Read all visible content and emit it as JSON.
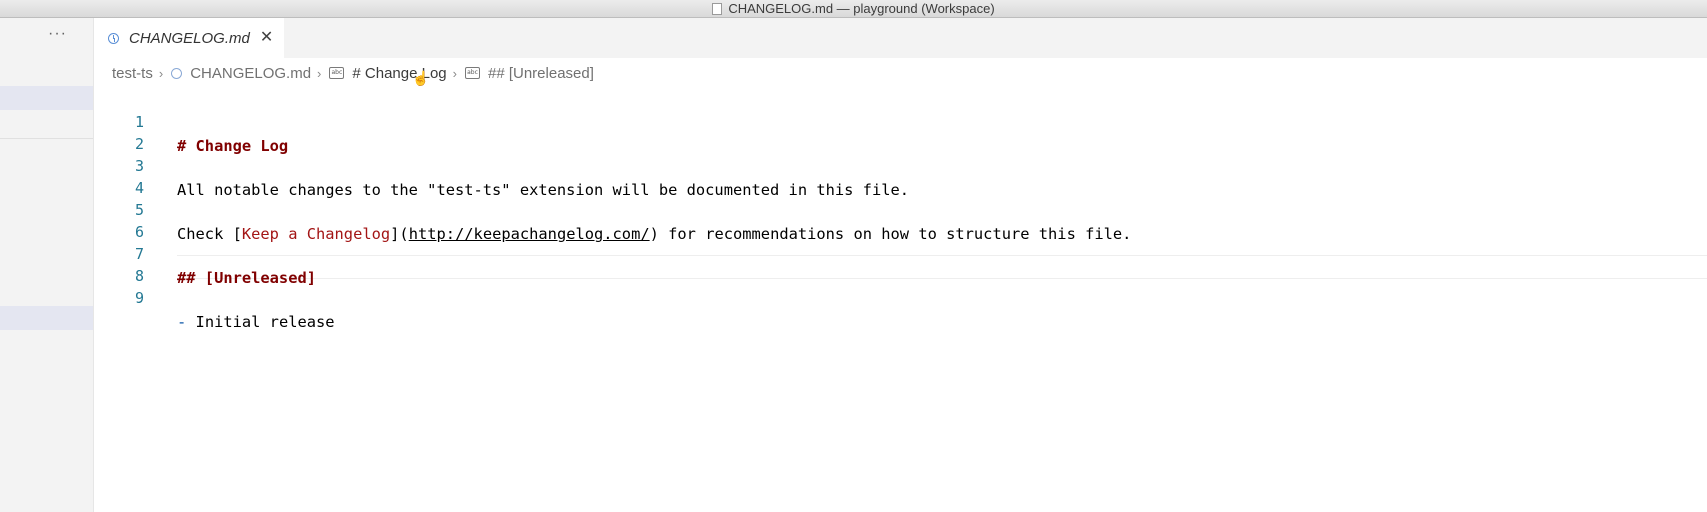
{
  "window": {
    "title": "CHANGELOG.md — playground (Workspace)",
    "file_icon": "file-icon"
  },
  "sidebar": {
    "more_label": "···"
  },
  "tabs": [
    {
      "label": "CHANGELOG.md",
      "icon": "markdown-preview-icon",
      "close_label": "✕",
      "active": true
    }
  ],
  "breadcrumb": {
    "items": [
      {
        "label": "test-ts"
      },
      {
        "label": "CHANGELOG.md",
        "icon": "markdown-icon"
      },
      {
        "label": "# Change Log",
        "icon": "string-symbol-icon"
      },
      {
        "label": "## [Unreleased]",
        "icon": "string-symbol-icon"
      }
    ],
    "separator": "›"
  },
  "editor": {
    "lines": [
      {
        "number": "1",
        "text": "# Change Log"
      },
      {
        "number": "2",
        "text": ""
      },
      {
        "number": "3",
        "text": "All notable changes to the \"test-ts\" extension will be documented in this file."
      },
      {
        "number": "4",
        "text": ""
      },
      {
        "number": "5",
        "prefix": "Check [",
        "link_text": "Keep a Changelog",
        "middle": "](",
        "link_url": "http://keepachangelog.com/",
        "suffix": ") for recommendations on how to structure this file."
      },
      {
        "number": "6",
        "text": ""
      },
      {
        "number": "7",
        "text": "## [Unreleased]"
      },
      {
        "number": "8",
        "text": ""
      },
      {
        "number": "9",
        "bullet": "-",
        "text": " Initial release"
      }
    ],
    "current_line": 8,
    "colors": {
      "heading": "#800000",
      "link_text": "#a31515",
      "line_number": "#237893"
    }
  }
}
